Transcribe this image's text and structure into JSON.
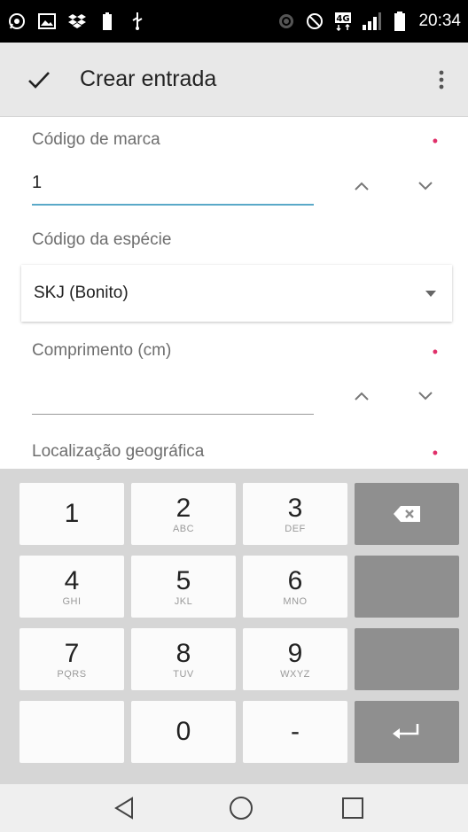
{
  "status_bar": {
    "time": "20:34",
    "left_icons": [
      "whatsapp-icon",
      "image-icon",
      "dropbox-icon",
      "battery-saver-icon",
      "usb-icon"
    ],
    "right_icons": [
      "nfc-icon",
      "do-not-disturb-icon",
      "4g-icon",
      "signal-icon",
      "battery-icon"
    ],
    "network_type": "4G"
  },
  "app_bar": {
    "title": "Crear entrada",
    "confirm_icon": "check-icon",
    "menu_icon": "more-vert-icon"
  },
  "form": {
    "brand_code": {
      "label": "Código de marca",
      "value": "1",
      "required": true,
      "required_marker": "•"
    },
    "species_code": {
      "label": "Código da espécie",
      "selected": "SKJ (Bonito)"
    },
    "length": {
      "label": "Comprimento (cm)",
      "value": "",
      "required": true,
      "required_marker": "•"
    },
    "geo_location": {
      "label": "Localização geográfica",
      "required": true,
      "required_marker": "•"
    }
  },
  "keyboard": {
    "keys": [
      {
        "main": "1",
        "sub": ""
      },
      {
        "main": "2",
        "sub": "ABC"
      },
      {
        "main": "3",
        "sub": "DEF"
      },
      {
        "main": "4",
        "sub": "GHI"
      },
      {
        "main": "5",
        "sub": "JKL"
      },
      {
        "main": "6",
        "sub": "MNO"
      },
      {
        "main": "7",
        "sub": "PQRS"
      },
      {
        "main": "8",
        "sub": "TUV"
      },
      {
        "main": "9",
        "sub": "WXYZ"
      },
      {
        "main": "",
        "sub": ""
      },
      {
        "main": "0",
        "sub": ""
      },
      {
        "main": "-",
        "sub": ""
      }
    ],
    "special_keys": [
      "backspace-icon",
      "enter-icon"
    ]
  },
  "nav_bar": {
    "icons": [
      "back-icon",
      "home-icon",
      "recents-icon"
    ]
  },
  "colors": {
    "accent": "#5aa9c8",
    "required": "#e0306a",
    "app_bar": "#e8e8e8",
    "keyboard_bg": "#d6d6d6",
    "dark_key": "#8f8f8f"
  }
}
